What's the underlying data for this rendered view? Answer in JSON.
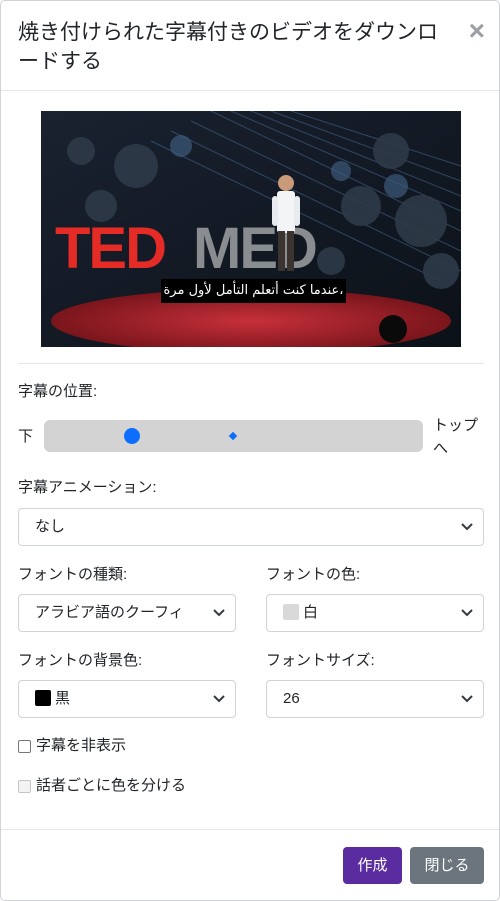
{
  "modal": {
    "title": "焼き付けられた字幕付きのビデオをダウンロードする",
    "close_symbol": "×"
  },
  "video": {
    "subtitle_text": "عندما كنت أتعلم التأمل لأول مرة،"
  },
  "position": {
    "label": "字幕の位置:",
    "min_label": "下",
    "max_label": "トップへ",
    "value_fraction": 0.22
  },
  "animation": {
    "label": "字幕アニメーション:",
    "selected": "なし"
  },
  "font_type": {
    "label": "フォントの種類:",
    "selected": "アラビア語のクーフィ"
  },
  "font_color": {
    "label": "フォントの色:",
    "selected": "白",
    "swatch_color": "#d9d9d9"
  },
  "bg_color": {
    "label": "フォントの背景色:",
    "selected": "黒",
    "swatch_color": "#000000"
  },
  "font_size": {
    "label": "フォントサイズ:",
    "selected": "26"
  },
  "options": {
    "hide_subtitles": "字幕を非表示",
    "color_by_speaker": "話者ごとに色を分ける"
  },
  "footer": {
    "create_label": "作成",
    "close_label": "閉じる"
  },
  "colors": {
    "primary": "#5a2ca0",
    "secondary": "#6c757d",
    "slider_accent": "#0d6efd"
  }
}
